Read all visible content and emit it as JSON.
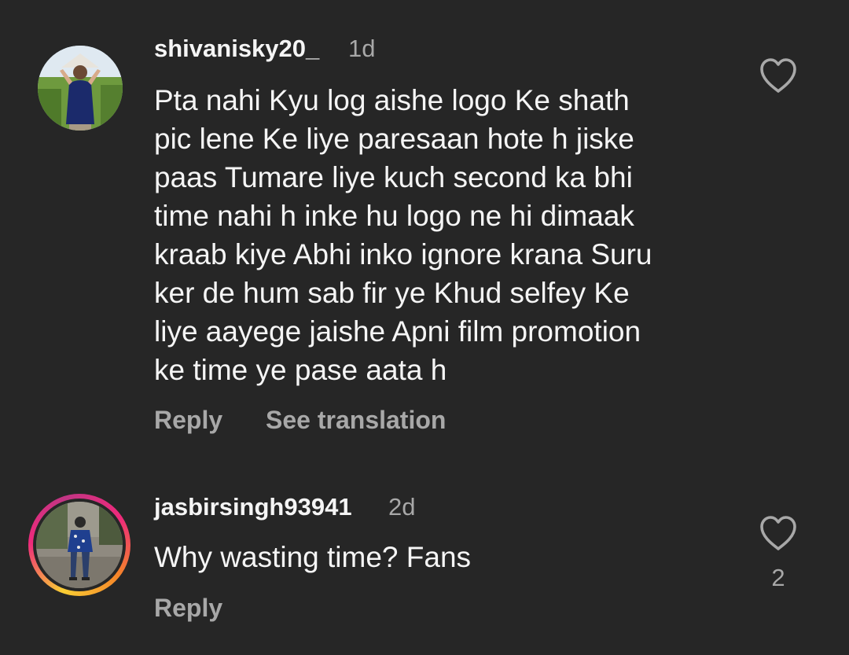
{
  "comments": [
    {
      "username": "shivanisky20_",
      "time": "1d",
      "text": "Pta nahi Kyu log aishe logo Ke shath\npic lene Ke liye paresaan hote h jiske\npaas Tumare liye kuch second ka bhi\ntime nahi h inke hu logo  ne hi  dimaak\nkraab kiye Abhi inko ignore krana Suru\nker de hum sab fir ye Khud selfey Ke\nliye aayege jaishe Apni film promotion\nke time ye pase aata h",
      "reply_label": "Reply",
      "translate_label": "See translation",
      "like_icon": "heart-outline-icon"
    },
    {
      "username": "jasbirsingh93941",
      "time": "2d",
      "text": "Why wasting time? Fans",
      "reply_label": "Reply",
      "like_icon": "heart-outline-icon",
      "like_count": "2",
      "story_ring": true
    }
  ],
  "colors": {
    "background": "#262626",
    "primary_text": "#f5f5f5",
    "secondary_text": "#a8a8a8"
  }
}
